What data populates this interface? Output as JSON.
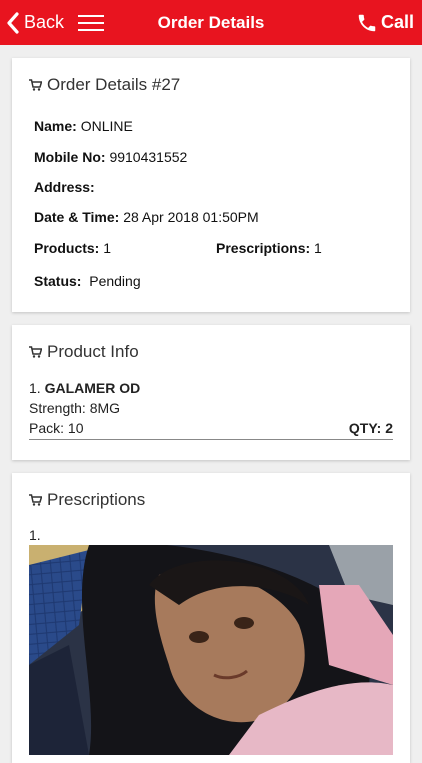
{
  "header": {
    "back_label": "Back",
    "title": "Order Details",
    "call_label": "Call"
  },
  "order": {
    "heading": "Order Details #27",
    "name_label": "Name:",
    "name_value": "ONLINE",
    "mobile_label": "Mobile No:",
    "mobile_value": "9910431552",
    "address_label": "Address:",
    "datetime_label": "Date & Time:",
    "datetime_value": "28 Apr 2018 01:50PM",
    "products_label": "Products:",
    "products_value": "1",
    "prescriptions_label": "Prescriptions:",
    "prescriptions_value": "1",
    "status_label": "Status:",
    "status_value": "Pending"
  },
  "product_info": {
    "heading": "Product Info",
    "items": [
      {
        "index": "1.",
        "name": "GALAMER OD",
        "strength": "Strength: 8MG",
        "pack": "Pack: 10",
        "qty": "QTY: 2"
      }
    ]
  },
  "prescriptions": {
    "heading": "Prescriptions",
    "items": [
      {
        "index": "1."
      }
    ]
  },
  "colors": {
    "brand": "#e8141f",
    "background": "#efefef"
  }
}
